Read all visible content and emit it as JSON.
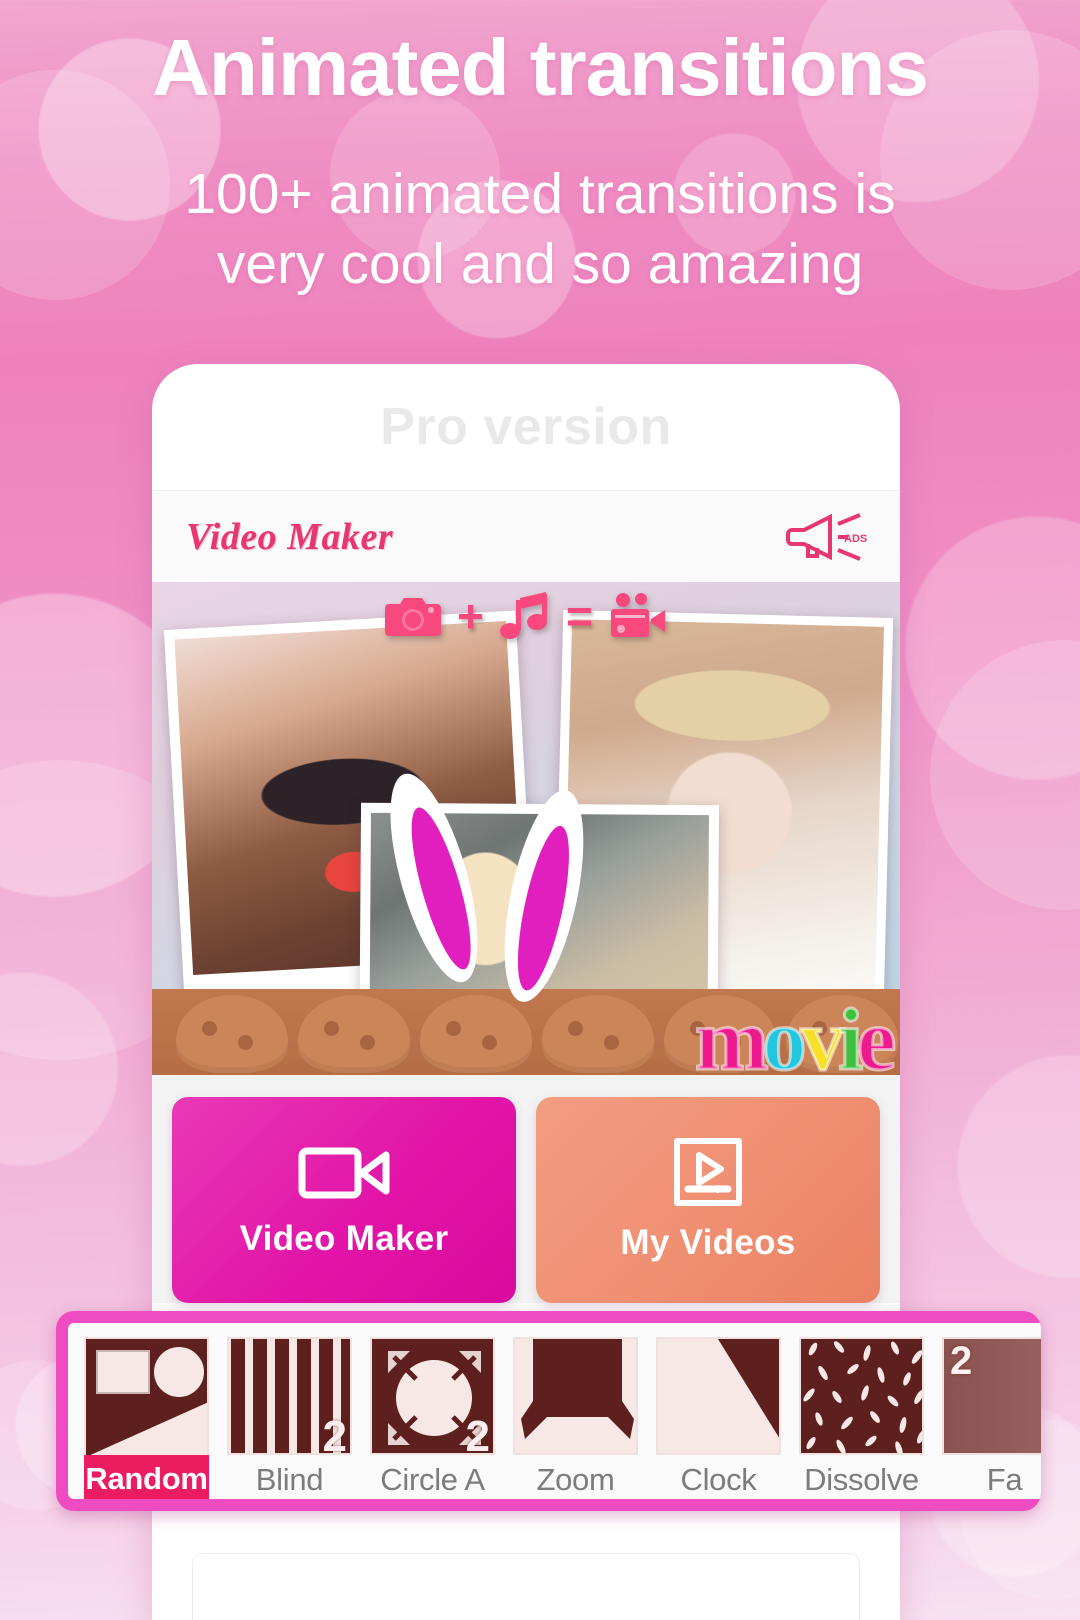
{
  "promo": {
    "headline": "Animated transitions",
    "subheadline_line1": "100+ animated transitions is",
    "subheadline_line2": "very cool and so amazing"
  },
  "phone": {
    "pro_label": "Pro version",
    "appbar": {
      "brand": "Video Maker",
      "ads_icon": "megaphone-ads-icon",
      "ads_text": "ADS"
    },
    "collage": {
      "formula": {
        "camera_icon": "camera-icon",
        "plus": "+",
        "music_icon": "music-note-icon",
        "equals": "=",
        "video_icon": "video-camera-icon"
      },
      "sticker_text": "movie",
      "sticker_colors": [
        "#ec1a8d",
        "#24c6dd",
        "#f7e02a",
        "#3fc13f"
      ]
    },
    "actions": [
      {
        "label": "Video Maker",
        "icon": "video-camera-icon",
        "color": "#e215a8"
      },
      {
        "label": "My Videos",
        "icon": "video-play-file-icon",
        "color": "#ef8f72"
      }
    ]
  },
  "transitions": {
    "accent_border": "#ee4cc0",
    "active_label_bg": "#ec1c60",
    "items": [
      {
        "label": "Random",
        "icon": "random-shapes-icon",
        "badge": "",
        "active": true
      },
      {
        "label": "Blind",
        "icon": "vertical-blinds-icon",
        "badge": "2",
        "active": false
      },
      {
        "label": "Circle A",
        "icon": "circle-arrows-icon",
        "badge": "2",
        "active": false
      },
      {
        "label": "Zoom",
        "icon": "zoom-arrows-icon",
        "badge": "",
        "active": false
      },
      {
        "label": "Clock",
        "icon": "clock-wipe-icon",
        "badge": "",
        "active": false
      },
      {
        "label": "Dissolve",
        "icon": "dissolve-specks-icon",
        "badge": "",
        "active": false
      },
      {
        "label": "Fa",
        "icon": "fade-icon",
        "badge": "2",
        "active": false
      }
    ]
  }
}
